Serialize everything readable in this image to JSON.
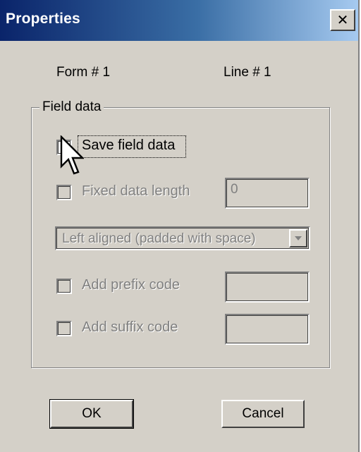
{
  "window": {
    "title": "Properties",
    "close_label": "✕"
  },
  "info": {
    "form_label": "Form # 1",
    "line_label": "Line # 1"
  },
  "field_data": {
    "group_label": "Field data",
    "save_field_data": {
      "label": "Save field data",
      "checked": false,
      "enabled": true
    },
    "fixed_data_length": {
      "label": "Fixed data length",
      "checked": false,
      "enabled": false,
      "value": "0"
    },
    "alignment": {
      "selected": "Left aligned (padded with space)",
      "enabled": false
    },
    "add_prefix_code": {
      "label": "Add prefix code",
      "checked": false,
      "enabled": false,
      "value": ""
    },
    "add_suffix_code": {
      "label": "Add suffix code",
      "checked": false,
      "enabled": false,
      "value": ""
    }
  },
  "buttons": {
    "ok_label": "OK",
    "cancel_label": "Cancel"
  },
  "colors": {
    "dialog_bg": "#d4d0c8",
    "title_start": "#0a246a",
    "title_end": "#a6caf0",
    "disabled_text": "#808080"
  },
  "icons": {
    "cursor": "arrow-cursor-icon",
    "close": "close-icon",
    "dropdown": "chevron-down-icon"
  }
}
